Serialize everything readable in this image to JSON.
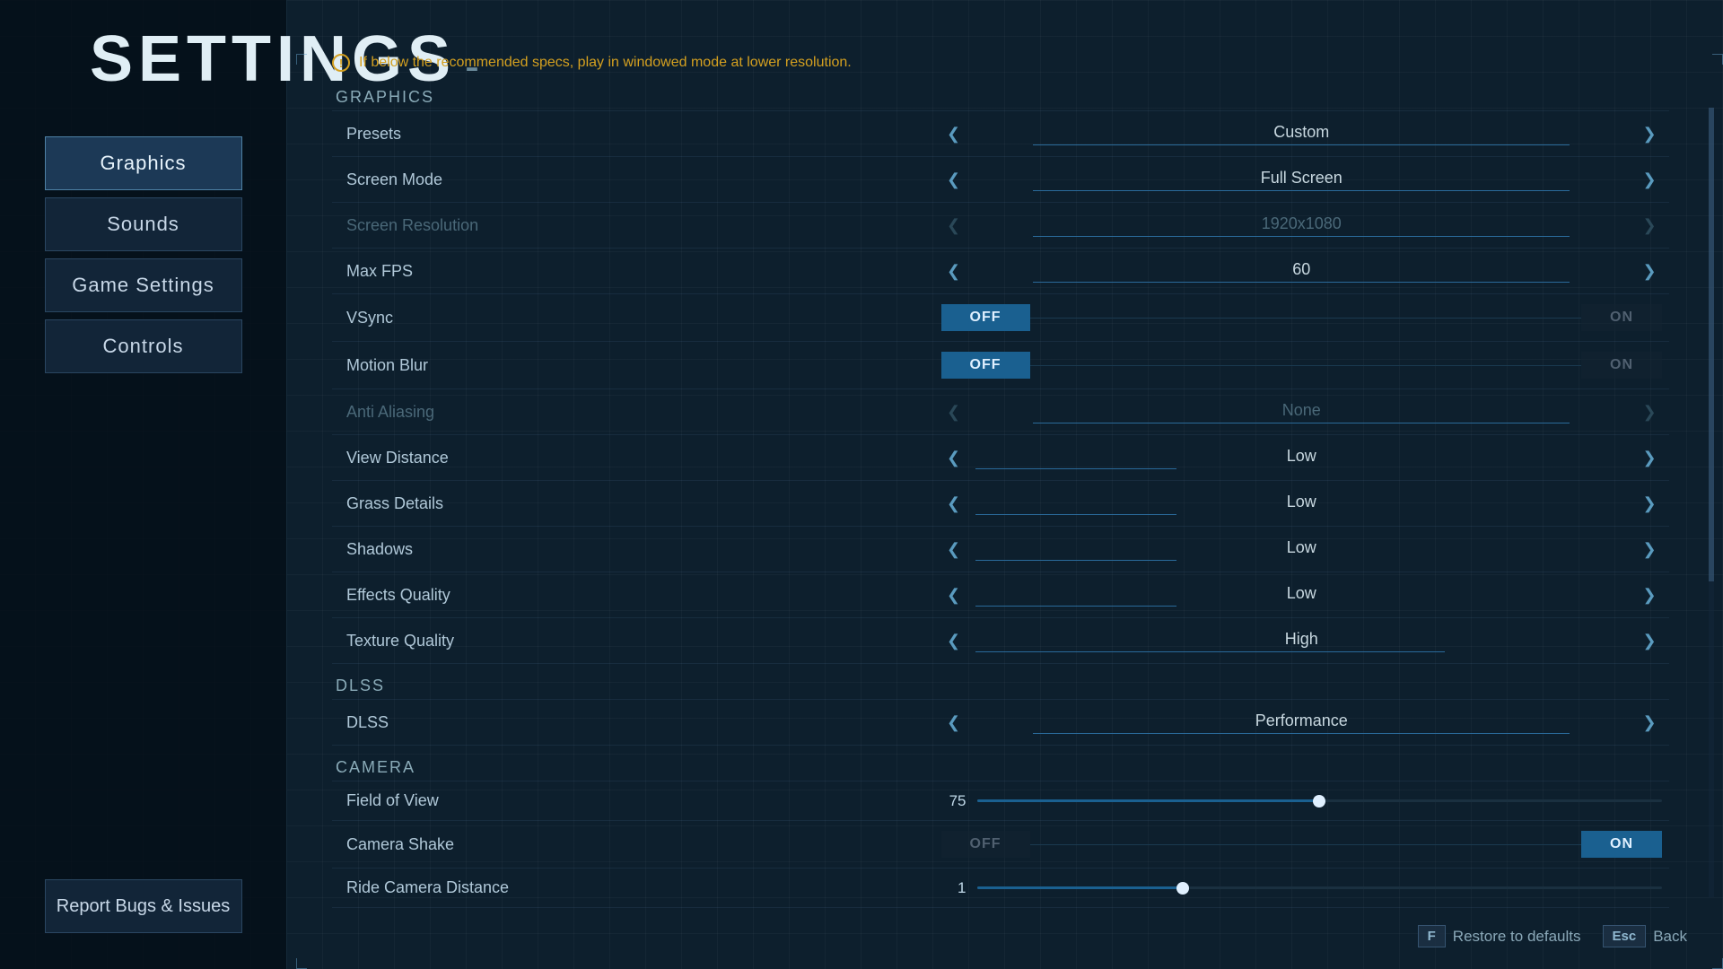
{
  "sidebar": {
    "title": "SETTINGS",
    "dash": "-",
    "nav": [
      {
        "label": "Graphics",
        "active": true
      },
      {
        "label": "Sounds",
        "active": false
      },
      {
        "label": "Game Settings",
        "active": false
      },
      {
        "label": "Controls",
        "active": false
      }
    ],
    "report_label": "Report Bugs & Issues"
  },
  "warning": {
    "text": "If below the recommended specs, play in windowed mode at lower resolution."
  },
  "graphics_section": {
    "title": "Graphics",
    "rows": [
      {
        "label": "Presets",
        "type": "arrow",
        "value": "Custom",
        "disabled": false
      },
      {
        "label": "Screen Mode",
        "type": "arrow",
        "value": "Full Screen",
        "disabled": false
      },
      {
        "label": "Screen Resolution",
        "type": "arrow",
        "value": "1920x1080",
        "disabled": true
      },
      {
        "label": "Max FPS",
        "type": "arrow",
        "value": "60",
        "disabled": false
      },
      {
        "label": "VSync",
        "type": "toggle",
        "value": "OFF",
        "disabled": false
      },
      {
        "label": "Motion Blur",
        "type": "toggle",
        "value": "OFF",
        "disabled": false
      },
      {
        "label": "Anti Aliasing",
        "type": "arrow",
        "value": "None",
        "disabled": true
      },
      {
        "label": "View Distance",
        "type": "arrow_quality",
        "value": "Low",
        "disabled": false
      },
      {
        "label": "Grass Details",
        "type": "arrow_quality",
        "value": "Low",
        "disabled": false
      },
      {
        "label": "Shadows",
        "type": "arrow_quality",
        "value": "Low",
        "disabled": false
      },
      {
        "label": "Effects Quality",
        "type": "arrow_quality",
        "value": "Low",
        "disabled": false
      },
      {
        "label": "Texture Quality",
        "type": "arrow_quality",
        "value": "High",
        "disabled": false
      }
    ]
  },
  "dlss_section": {
    "title": "DLSS",
    "rows": [
      {
        "label": "DLSS",
        "type": "arrow",
        "value": "Performance",
        "disabled": false
      }
    ]
  },
  "camera_section": {
    "title": "Camera",
    "rows": [
      {
        "label": "Field of View",
        "type": "slider",
        "value": "75",
        "percent": 50,
        "disabled": false
      },
      {
        "label": "Camera Shake",
        "type": "toggle_on",
        "value": "ON",
        "disabled": false
      },
      {
        "label": "Ride Camera Distance",
        "type": "slider",
        "value": "1",
        "percent": 30,
        "disabled": false
      }
    ]
  },
  "bottom": {
    "restore_key": "F",
    "restore_label": "Restore to defaults",
    "back_key": "Esc",
    "back_label": "Back"
  }
}
